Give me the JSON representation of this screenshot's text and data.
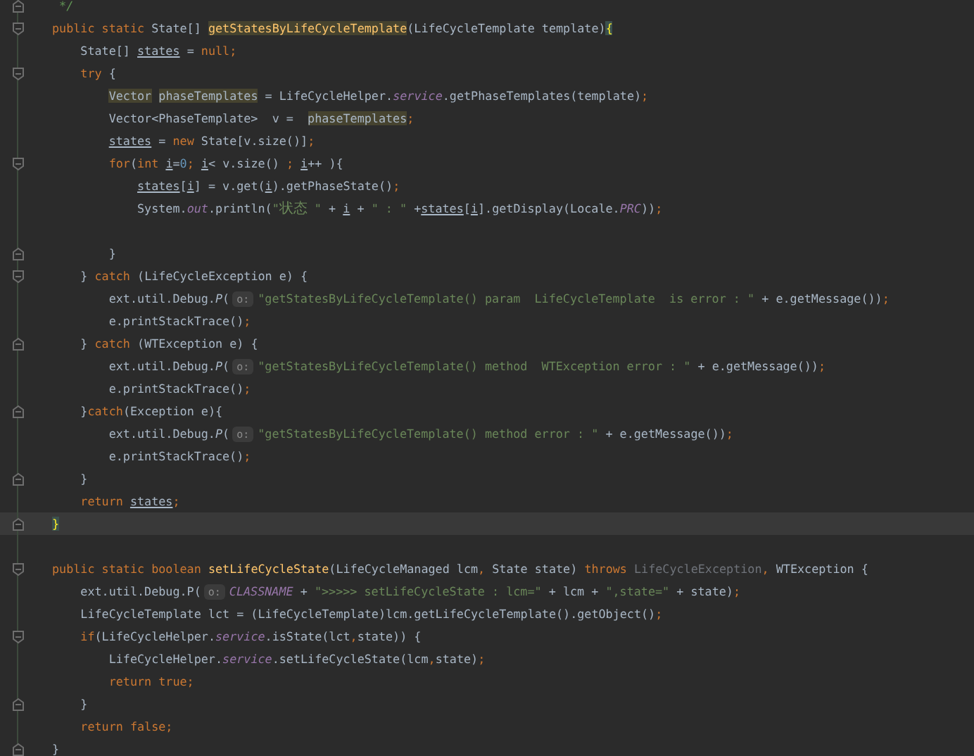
{
  "editor": {
    "lines": [
      {
        "current": false,
        "kind": "fold-end",
        "tokens": [
          {
            "kind": "comment",
            "text": " */"
          }
        ]
      },
      {
        "current": false,
        "kind": "fold-start",
        "tokens": [
          {
            "kind": "keyword",
            "text": "public static "
          },
          {
            "kind": "plain",
            "text": "State[] "
          },
          {
            "kind": "decl-usage",
            "text": "getStatesByLifeCycleTemplate"
          },
          {
            "kind": "plain",
            "text": "(LifeCycleTemplate template)"
          },
          {
            "kind": "brace",
            "text": "{"
          }
        ]
      },
      {
        "current": false,
        "kind": "plain",
        "tokens": [
          {
            "kind": "plain",
            "text": "    State[] "
          },
          {
            "kind": "var",
            "text": "states"
          },
          {
            "kind": "plain",
            "text": " = "
          },
          {
            "kind": "keyword",
            "text": "null;"
          }
        ]
      },
      {
        "current": false,
        "kind": "fold-start",
        "tokens": [
          {
            "kind": "keyword",
            "text": "    try"
          },
          {
            "kind": "plain",
            "text": " {"
          }
        ]
      },
      {
        "current": false,
        "kind": "plain",
        "tokens": [
          {
            "kind": "usage",
            "text": "        Vector"
          },
          {
            "kind": "usage",
            "text": " phaseTemplates"
          },
          {
            "kind": "plain",
            "text": " = LifeCycleHelper."
          },
          {
            "kind": "field",
            "text": "service"
          },
          {
            "kind": "plain",
            "text": ".getPhaseTemplates(template)"
          },
          {
            "kind": "keyword",
            "text": ";"
          }
        ]
      },
      {
        "current": false,
        "kind": "plain",
        "tokens": [
          {
            "kind": "plain",
            "text": "        Vector<PhaseTemplate>  v =  "
          },
          {
            "kind": "usage",
            "text": "phaseTemplates"
          },
          {
            "kind": "keyword",
            "text": ";"
          }
        ]
      },
      {
        "current": false,
        "kind": "plain",
        "tokens": [
          {
            "kind": "var",
            "text": "        states"
          },
          {
            "kind": "plain",
            "text": " = "
          },
          {
            "kind": "keyword",
            "text": "new "
          },
          {
            "kind": "plain",
            "text": "State[v.size()]"
          },
          {
            "kind": "keyword",
            "text": ";"
          }
        ]
      },
      {
        "current": false,
        "kind": "fold-start",
        "tokens": [
          {
            "kind": "keyword",
            "text": "        for"
          },
          {
            "kind": "plain",
            "text": "("
          },
          {
            "kind": "keyword",
            "text": "int "
          },
          {
            "kind": "var",
            "text": "i"
          },
          {
            "kind": "plain",
            "text": "="
          },
          {
            "kind": "number",
            "text": "0"
          },
          {
            "kind": "keyword",
            "text": "; "
          },
          {
            "kind": "var",
            "text": "i"
          },
          {
            "kind": "plain",
            "text": "< v.size() "
          },
          {
            "kind": "keyword",
            "text": "; "
          },
          {
            "kind": "var",
            "text": "i"
          },
          {
            "kind": "plain",
            "text": "++ ){"
          }
        ]
      },
      {
        "current": false,
        "kind": "plain",
        "tokens": [
          {
            "kind": "var",
            "text": "            states"
          },
          {
            "kind": "plain",
            "text": "["
          },
          {
            "kind": "var",
            "text": "i"
          },
          {
            "kind": "plain",
            "text": "] = v.get("
          },
          {
            "kind": "var",
            "text": "i"
          },
          {
            "kind": "plain",
            "text": ").getPhaseState()"
          },
          {
            "kind": "keyword",
            "text": ";"
          }
        ]
      },
      {
        "current": false,
        "kind": "plain",
        "tokens": [
          {
            "kind": "plain",
            "text": "            System."
          },
          {
            "kind": "field",
            "text": "out"
          },
          {
            "kind": "plain",
            "text": ".println("
          },
          {
            "kind": "string",
            "text": "\"状态 \""
          },
          {
            "kind": "plain",
            "text": " + "
          },
          {
            "kind": "var",
            "text": "i"
          },
          {
            "kind": "plain",
            "text": " + "
          },
          {
            "kind": "string",
            "text": "\" : \""
          },
          {
            "kind": "plain",
            "text": " +"
          },
          {
            "kind": "var",
            "text": "states"
          },
          {
            "kind": "plain",
            "text": "["
          },
          {
            "kind": "var",
            "text": "i"
          },
          {
            "kind": "plain",
            "text": "].getDisplay(Locale."
          },
          {
            "kind": "field",
            "text": "PRC"
          },
          {
            "kind": "plain",
            "text": "))"
          },
          {
            "kind": "keyword",
            "text": ";"
          }
        ]
      },
      {
        "current": false,
        "kind": "plain"
      },
      {
        "current": false,
        "kind": "fold-end",
        "tokens": [
          {
            "kind": "plain",
            "text": "        }"
          }
        ]
      },
      {
        "current": false,
        "kind": "fold-start",
        "tokens": [
          {
            "kind": "plain",
            "text": "    } "
          },
          {
            "kind": "keyword",
            "text": "catch"
          },
          {
            "kind": "plain",
            "text": " (LifeCycleException e) {"
          }
        ]
      },
      {
        "current": false,
        "kind": "plain",
        "tokens": [
          {
            "kind": "plain",
            "text": "        ext.util.Debug."
          },
          {
            "kind": "italic",
            "text": "P"
          },
          {
            "kind": "plain",
            "text": "("
          },
          {
            "kind": "hint",
            "text": "o:"
          },
          {
            "kind": "string",
            "text": "\"getStatesByLifeCycleTemplate() param  LifeCycleTemplate  is error : \""
          },
          {
            "kind": "plain",
            "text": " + e.getMessage())"
          },
          {
            "kind": "keyword",
            "text": ";"
          }
        ]
      },
      {
        "current": false,
        "kind": "plain",
        "tokens": [
          {
            "kind": "plain",
            "text": "        e.printStackTrace()"
          },
          {
            "kind": "keyword",
            "text": ";"
          }
        ]
      },
      {
        "current": false,
        "kind": "fold-end",
        "tokens": [
          {
            "kind": "plain",
            "text": "    } "
          },
          {
            "kind": "keyword",
            "text": "catch"
          },
          {
            "kind": "plain",
            "text": " (WTException e) {"
          }
        ]
      },
      {
        "current": false,
        "kind": "plain",
        "tokens": [
          {
            "kind": "plain",
            "text": "        ext.util.Debug."
          },
          {
            "kind": "italic",
            "text": "P"
          },
          {
            "kind": "plain",
            "text": "("
          },
          {
            "kind": "hint",
            "text": "o:"
          },
          {
            "kind": "string",
            "text": "\"getStatesByLifeCycleTemplate() method  WTException error : \""
          },
          {
            "kind": "plain",
            "text": " + e.getMessage())"
          },
          {
            "kind": "keyword",
            "text": ";"
          }
        ]
      },
      {
        "current": false,
        "kind": "plain",
        "tokens": [
          {
            "kind": "plain",
            "text": "        e.printStackTrace()"
          },
          {
            "kind": "keyword",
            "text": ";"
          }
        ]
      },
      {
        "current": false,
        "kind": "fold-end",
        "tokens": [
          {
            "kind": "plain",
            "text": "    }"
          },
          {
            "kind": "keyword",
            "text": "catch"
          },
          {
            "kind": "plain",
            "text": "(Exception e){"
          }
        ]
      },
      {
        "current": false,
        "kind": "plain",
        "tokens": [
          {
            "kind": "plain",
            "text": "        ext.util.Debug."
          },
          {
            "kind": "italic",
            "text": "P"
          },
          {
            "kind": "plain",
            "text": "("
          },
          {
            "kind": "hint",
            "text": "o:"
          },
          {
            "kind": "string",
            "text": "\"getStatesByLifeCycleTemplate() method error : \""
          },
          {
            "kind": "plain",
            "text": " + e.getMessage())"
          },
          {
            "kind": "keyword",
            "text": ";"
          }
        ]
      },
      {
        "current": false,
        "kind": "plain",
        "tokens": [
          {
            "kind": "plain",
            "text": "        e.printStackTrace()"
          },
          {
            "kind": "keyword",
            "text": ";"
          }
        ]
      },
      {
        "current": false,
        "kind": "fold-end",
        "tokens": [
          {
            "kind": "plain",
            "text": "    }"
          }
        ]
      },
      {
        "current": false,
        "kind": "plain",
        "tokens": [
          {
            "kind": "keyword",
            "text": "    return "
          },
          {
            "kind": "var",
            "text": "states"
          },
          {
            "kind": "keyword",
            "text": ";"
          }
        ]
      },
      {
        "current": true,
        "kind": "fold-end",
        "tokens": [
          {
            "kind": "brace",
            "text": "}"
          }
        ]
      },
      {
        "current": false,
        "kind": "plain"
      },
      {
        "current": false,
        "kind": "fold-start",
        "tokens": [
          {
            "kind": "keyword",
            "text": "public static boolean "
          },
          {
            "kind": "decl",
            "text": "setLifeCycleState"
          },
          {
            "kind": "plain",
            "text": "(LifeCycleManaged lcm"
          },
          {
            "kind": "keyword",
            "text": ","
          },
          {
            "kind": "plain",
            "text": " State state) "
          },
          {
            "kind": "keyword",
            "text": "throws "
          },
          {
            "kind": "dim",
            "text": "LifeCycleException"
          },
          {
            "kind": "keyword",
            "text": ","
          },
          {
            "kind": "plain",
            "text": " WTException {"
          }
        ]
      },
      {
        "current": false,
        "kind": "plain",
        "tokens": [
          {
            "kind": "plain",
            "text": "    ext.util.Debug.P("
          },
          {
            "kind": "hint",
            "text": "o:"
          },
          {
            "kind": "field",
            "text": "CLASSNAME"
          },
          {
            "kind": "plain",
            "text": " + "
          },
          {
            "kind": "string",
            "text": "\">>>>> setLifeCycleState : lcm=\""
          },
          {
            "kind": "plain",
            "text": " + lcm + "
          },
          {
            "kind": "string",
            "text": "\",state=\""
          },
          {
            "kind": "plain",
            "text": " + state)"
          },
          {
            "kind": "keyword",
            "text": ";"
          }
        ]
      },
      {
        "current": false,
        "kind": "plain",
        "tokens": [
          {
            "kind": "plain",
            "text": "    LifeCycleTemplate lct = (LifeCycleTemplate)lcm.getLifeCycleTemplate().getObject()"
          },
          {
            "kind": "keyword",
            "text": ";"
          }
        ]
      },
      {
        "current": false,
        "kind": "fold-start",
        "tokens": [
          {
            "kind": "keyword",
            "text": "    if"
          },
          {
            "kind": "plain",
            "text": "(LifeCycleHelper."
          },
          {
            "kind": "field",
            "text": "service"
          },
          {
            "kind": "plain",
            "text": ".isState(lct"
          },
          {
            "kind": "keyword",
            "text": ","
          },
          {
            "kind": "plain",
            "text": "state)) {"
          }
        ]
      },
      {
        "current": false,
        "kind": "plain",
        "tokens": [
          {
            "kind": "plain",
            "text": "        LifeCycleHelper."
          },
          {
            "kind": "field",
            "text": "service"
          },
          {
            "kind": "plain",
            "text": ".setLifeCycleState(lcm"
          },
          {
            "kind": "keyword",
            "text": ","
          },
          {
            "kind": "plain",
            "text": "state)"
          },
          {
            "kind": "keyword",
            "text": ";"
          }
        ]
      },
      {
        "current": false,
        "kind": "plain",
        "tokens": [
          {
            "kind": "keyword",
            "text": "        return true;"
          }
        ]
      },
      {
        "current": false,
        "kind": "fold-end",
        "tokens": [
          {
            "kind": "plain",
            "text": "    }"
          }
        ]
      },
      {
        "current": false,
        "kind": "plain",
        "tokens": [
          {
            "kind": "keyword",
            "text": "    return false;"
          }
        ]
      },
      {
        "current": false,
        "kind": "fold-end",
        "tokens": [
          {
            "kind": "plain",
            "text": "}"
          }
        ]
      }
    ]
  }
}
